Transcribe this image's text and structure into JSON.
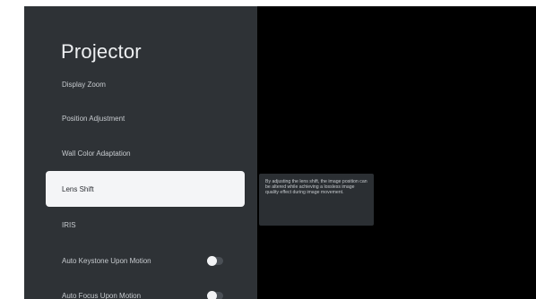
{
  "page": {
    "title": "Projector"
  },
  "menu": {
    "items": [
      {
        "label": "Display Zoom",
        "selected": false,
        "has_toggle": false
      },
      {
        "label": "Position Adjustment",
        "selected": false,
        "has_toggle": false
      },
      {
        "label": "Wall Color Adaptation",
        "selected": false,
        "has_toggle": false
      },
      {
        "label": "Lens Shift",
        "selected": true,
        "has_toggle": false
      },
      {
        "label": "IRIS",
        "selected": false,
        "has_toggle": false
      },
      {
        "label": "Auto Keystone Upon Motion",
        "selected": false,
        "has_toggle": true,
        "toggle_state": "off"
      },
      {
        "label": "Auto Focus Upon Motion",
        "selected": false,
        "has_toggle": true,
        "toggle_state": "off"
      }
    ]
  },
  "tooltip": {
    "text": "By adjusting the lens shift, the image position can be altered while achieving a lossless image quality effect during image movement."
  },
  "colors": {
    "panel_background": "#2e3236",
    "screen_background": "#000000",
    "selected_background": "#f4f5f7",
    "text_primary": "#eef0f2",
    "text_secondary": "#c7cbcf"
  }
}
